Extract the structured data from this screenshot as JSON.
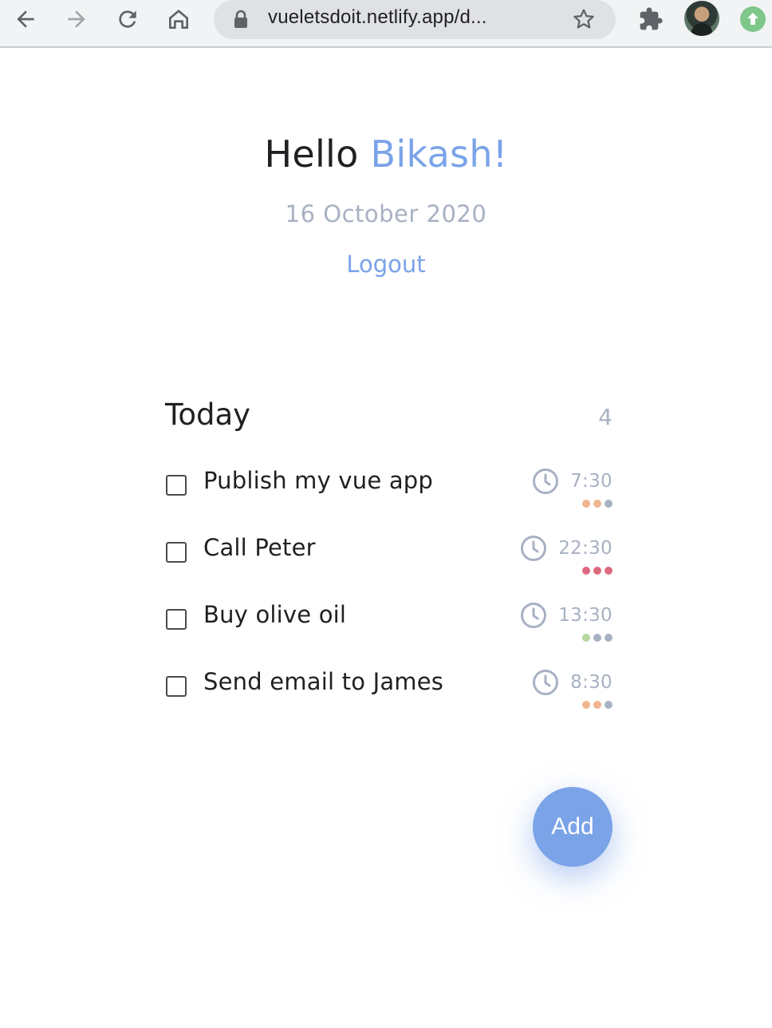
{
  "browser": {
    "url": "vueletsdoit.netlify.app/d..."
  },
  "header": {
    "greeting": "Hello",
    "user_name": "Bikash!",
    "date": "16 October 2020",
    "logout_label": "Logout"
  },
  "section": {
    "title": "Today",
    "count": "4"
  },
  "tasks": [
    {
      "title": "Publish my vue app",
      "time": "7:30",
      "dots": [
        "#f0b48e",
        "#f0b48e",
        "#a8b1c3"
      ]
    },
    {
      "title": "Call Peter",
      "time": "22:30",
      "dots": [
        "#de6a80",
        "#de6a80",
        "#de6a80"
      ]
    },
    {
      "title": "Buy olive oil",
      "time": "13:30",
      "dots": [
        "#b5d6a0",
        "#a8b1c3",
        "#a8b1c3"
      ]
    },
    {
      "title": "Send email to James",
      "time": "8:30",
      "dots": [
        "#f0b48e",
        "#f0b48e",
        "#a8b1c3"
      ]
    }
  ],
  "fab": {
    "label": "Add"
  },
  "colors": {
    "accent": "#7aa3e8",
    "muted": "#a8b1c3",
    "text": "#1f2023"
  },
  "icons": [
    "back-arrow-icon",
    "forward-arrow-icon",
    "reload-icon",
    "home-icon",
    "lock-icon",
    "star-icon",
    "extensions-puzzle-icon",
    "update-arrow-icon",
    "clock-icon"
  ]
}
